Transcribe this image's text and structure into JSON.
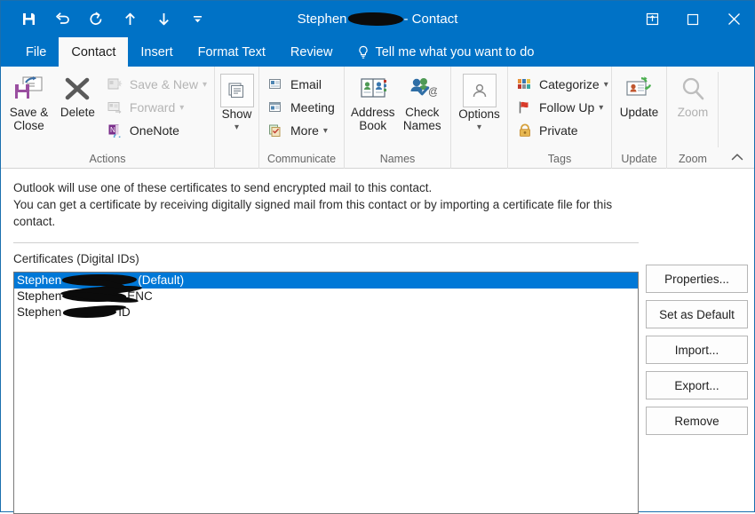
{
  "window": {
    "title_prefix": "Stephen",
    "title_suffix": "- Contact",
    "quick_access": [
      {
        "name": "save-icon",
        "label": "Save"
      },
      {
        "name": "undo-icon",
        "label": "Undo"
      },
      {
        "name": "redo-icon",
        "label": "Redo"
      },
      {
        "name": "previous-item-icon",
        "label": "Previous Item"
      },
      {
        "name": "next-item-icon",
        "label": "Next Item"
      },
      {
        "name": "customize-quick-access-toolbar-icon",
        "label": "Customize Quick Access Toolbar"
      }
    ],
    "controls": [
      {
        "name": "ribbon-display-options-icon",
        "label": "Ribbon Display Options"
      },
      {
        "name": "maximize-icon",
        "label": "Maximize"
      },
      {
        "name": "close-icon",
        "label": "Close"
      }
    ],
    "accent_color": "#0072c6",
    "border_color": "#1a6fae"
  },
  "tabs": [
    {
      "label": "File",
      "active": false
    },
    {
      "label": "Contact",
      "active": true
    },
    {
      "label": "Insert",
      "active": false
    },
    {
      "label": "Format Text",
      "active": false
    },
    {
      "label": "Review",
      "active": false
    }
  ],
  "tell_me": {
    "label": "Tell me what you want to do",
    "icon": "lightbulb-icon"
  },
  "ribbon": {
    "collapse_icon": "chevron-up-icon",
    "groups": [
      {
        "label": "Actions",
        "big_buttons": [
          {
            "label_line1": "Save &",
            "label_line2": "Close",
            "icon": "save-and-close-icon",
            "disabled": false
          },
          {
            "label_line1": "Delete",
            "label_line2": "",
            "icon": "delete-icon",
            "disabled": false
          }
        ],
        "small_buttons": [
          {
            "label": "Save & New",
            "icon": "save-and-new-icon",
            "disabled": true,
            "has_caret": true
          },
          {
            "label": "Forward",
            "icon": "forward-icon",
            "disabled": true,
            "has_caret": true
          },
          {
            "label": "OneNote",
            "icon": "onenote-icon",
            "disabled": false,
            "has_caret": false
          }
        ]
      },
      {
        "label": "",
        "big_buttons": [
          {
            "label_line1": "Show",
            "label_line2": "",
            "icon": "show-icon",
            "disabled": false,
            "boxed": true,
            "has_caret": true
          }
        ],
        "small_buttons": []
      },
      {
        "label": "Communicate",
        "big_buttons": [],
        "small_buttons": [
          {
            "label": "Email",
            "icon": "email-icon",
            "disabled": false,
            "has_caret": false
          },
          {
            "label": "Meeting",
            "icon": "meeting-icon",
            "disabled": false,
            "has_caret": false
          },
          {
            "label": "More",
            "icon": "more-icon",
            "disabled": false,
            "has_caret": true
          }
        ]
      },
      {
        "label": "Names",
        "big_buttons": [
          {
            "label_line1": "Address",
            "label_line2": "Book",
            "icon": "address-book-icon",
            "disabled": false
          },
          {
            "label_line1": "Check",
            "label_line2": "Names",
            "icon": "check-names-icon",
            "disabled": false
          }
        ],
        "small_buttons": []
      },
      {
        "label": "",
        "big_buttons": [
          {
            "label_line1": "Options",
            "label_line2": "",
            "icon": "options-icon",
            "disabled": false,
            "boxed": true,
            "has_caret": true
          }
        ],
        "small_buttons": []
      },
      {
        "label": "Tags",
        "big_buttons": [],
        "small_buttons": [
          {
            "label": "Categorize",
            "icon": "categorize-icon",
            "disabled": false,
            "has_caret": true
          },
          {
            "label": "Follow Up",
            "icon": "follow-up-flag-icon",
            "disabled": false,
            "has_caret": true
          },
          {
            "label": "Private",
            "icon": "private-lock-icon",
            "disabled": false,
            "has_caret": false
          }
        ]
      },
      {
        "label": "Update",
        "big_buttons": [
          {
            "label_line1": "Update",
            "label_line2": "",
            "icon": "update-icon",
            "disabled": false
          }
        ],
        "small_buttons": []
      },
      {
        "label": "Zoom",
        "big_buttons": [
          {
            "label_line1": "Zoom",
            "label_line2": "",
            "icon": "zoom-magnifier-icon",
            "disabled": true
          }
        ],
        "small_buttons": []
      }
    ]
  },
  "certificates_pane": {
    "info_line1": "Outlook will use one of these certificates to send encrypted mail to this contact.",
    "info_line2": "You can get a certificate by receiving digitally signed mail from this contact or by importing a certificate file for this",
    "info_line3": "contact.",
    "section_label": "Certificates (Digital IDs)",
    "selection_color": "#0078d7",
    "items": [
      {
        "prefix": "Stephen",
        "redacted": true,
        "suffix": "(Default)",
        "selected": true
      },
      {
        "prefix": "Stephen",
        "redacted": true,
        "suffix": "ENC",
        "selected": false
      },
      {
        "prefix": "Stephen",
        "redacted": true,
        "suffix": "ID",
        "selected": false
      }
    ],
    "buttons": [
      {
        "label": "Properties..."
      },
      {
        "label": "Set as Default"
      },
      {
        "label": "Import..."
      },
      {
        "label": "Export..."
      },
      {
        "label": "Remove"
      }
    ]
  }
}
